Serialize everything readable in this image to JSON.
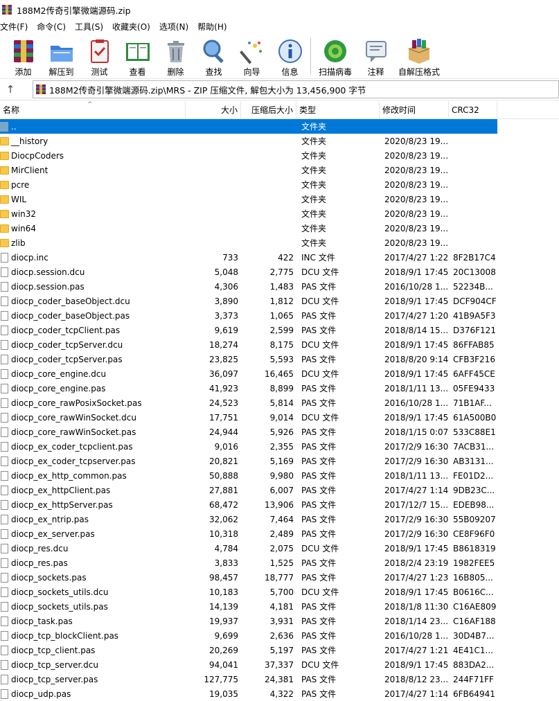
{
  "window": {
    "title": "188M2传奇引擎微端源码.zip"
  },
  "menu": [
    "文件(F)",
    "命令(C)",
    "工具(S)",
    "收藏夹(O)",
    "选项(N)",
    "帮助(H)"
  ],
  "toolbar": {
    "buttons": [
      {
        "label": "添加",
        "icon": "add-icon"
      },
      {
        "label": "解压到",
        "icon": "extract-to-icon"
      },
      {
        "label": "测试",
        "icon": "test-icon"
      },
      {
        "label": "查看",
        "icon": "view-icon"
      },
      {
        "label": "删除",
        "icon": "delete-icon"
      },
      {
        "label": "查找",
        "icon": "find-icon"
      },
      {
        "label": "向导",
        "icon": "wizard-icon"
      },
      {
        "label": "信息",
        "icon": "info-icon"
      },
      {
        "label": "扫描病毒",
        "icon": "virus-scan-icon"
      },
      {
        "label": "注释",
        "icon": "comment-icon"
      },
      {
        "label": "自解压格式",
        "icon": "sfx-icon"
      }
    ]
  },
  "address": {
    "path": "188M2传奇引擎微端源码.zip\\MRS - ZIP 压缩文件, 解包大小为 13,456,900 字节"
  },
  "columns": {
    "name": "名称",
    "size": "大小",
    "packed": "压缩后大小",
    "type": "类型",
    "modified": "修改时间",
    "crc": "CRC32"
  },
  "rows": [
    {
      "name": "..",
      "size": "",
      "packed": "",
      "type": "文件夹",
      "modified": "",
      "crc": "",
      "kind": "up"
    },
    {
      "name": "__history",
      "size": "",
      "packed": "",
      "type": "文件夹",
      "modified": "2020/8/23 19...",
      "crc": "",
      "kind": "folder"
    },
    {
      "name": "DiocpCoders",
      "size": "",
      "packed": "",
      "type": "文件夹",
      "modified": "2020/8/23 19...",
      "crc": "",
      "kind": "folder"
    },
    {
      "name": "MirClient",
      "size": "",
      "packed": "",
      "type": "文件夹",
      "modified": "2020/8/23 19...",
      "crc": "",
      "kind": "folder"
    },
    {
      "name": "pcre",
      "size": "",
      "packed": "",
      "type": "文件夹",
      "modified": "2020/8/23 19...",
      "crc": "",
      "kind": "folder"
    },
    {
      "name": "WIL",
      "size": "",
      "packed": "",
      "type": "文件夹",
      "modified": "2020/8/23 19...",
      "crc": "",
      "kind": "folder"
    },
    {
      "name": "win32",
      "size": "",
      "packed": "",
      "type": "文件夹",
      "modified": "2020/8/23 19...",
      "crc": "",
      "kind": "folder"
    },
    {
      "name": "win64",
      "size": "",
      "packed": "",
      "type": "文件夹",
      "modified": "2020/8/23 19...",
      "crc": "",
      "kind": "folder"
    },
    {
      "name": "zlib",
      "size": "",
      "packed": "",
      "type": "文件夹",
      "modified": "2020/8/23 19...",
      "crc": "",
      "kind": "folder"
    },
    {
      "name": "diocp.inc",
      "size": "733",
      "packed": "422",
      "type": "INC 文件",
      "modified": "2017/4/27 1:22",
      "crc": "8F2B17C4",
      "kind": "file"
    },
    {
      "name": "diocp.session.dcu",
      "size": "5,048",
      "packed": "2,775",
      "type": "DCU 文件",
      "modified": "2018/9/1 17:45",
      "crc": "20C13008",
      "kind": "file"
    },
    {
      "name": "diocp.session.pas",
      "size": "4,306",
      "packed": "1,483",
      "type": "PAS 文件",
      "modified": "2016/10/28 1...",
      "crc": "52234B...",
      "kind": "file"
    },
    {
      "name": "diocp_coder_baseObject.dcu",
      "size": "3,890",
      "packed": "1,812",
      "type": "DCU 文件",
      "modified": "2018/9/1 17:45",
      "crc": "DCF904CF",
      "kind": "file"
    },
    {
      "name": "diocp_coder_baseObject.pas",
      "size": "3,373",
      "packed": "1,065",
      "type": "PAS 文件",
      "modified": "2017/4/27 1:20",
      "crc": "41B9A5F3",
      "kind": "file"
    },
    {
      "name": "diocp_coder_tcpClient.pas",
      "size": "9,619",
      "packed": "2,599",
      "type": "PAS 文件",
      "modified": "2018/8/14 15...",
      "crc": "D376F121",
      "kind": "file"
    },
    {
      "name": "diocp_coder_tcpServer.dcu",
      "size": "18,274",
      "packed": "8,175",
      "type": "DCU 文件",
      "modified": "2018/9/1 17:45",
      "crc": "86FFAB85",
      "kind": "file"
    },
    {
      "name": "diocp_coder_tcpServer.pas",
      "size": "23,825",
      "packed": "5,593",
      "type": "PAS 文件",
      "modified": "2018/8/20 9:14",
      "crc": "CFB3F216",
      "kind": "file"
    },
    {
      "name": "diocp_core_engine.dcu",
      "size": "36,097",
      "packed": "16,465",
      "type": "DCU 文件",
      "modified": "2018/9/1 17:45",
      "crc": "6AFF45CE",
      "kind": "file"
    },
    {
      "name": "diocp_core_engine.pas",
      "size": "41,923",
      "packed": "8,899",
      "type": "PAS 文件",
      "modified": "2018/1/11 13...",
      "crc": "05FE9433",
      "kind": "file"
    },
    {
      "name": "diocp_core_rawPosixSocket.pas",
      "size": "24,523",
      "packed": "5,814",
      "type": "PAS 文件",
      "modified": "2016/10/28 1...",
      "crc": "71B1AF...",
      "kind": "file"
    },
    {
      "name": "diocp_core_rawWinSocket.dcu",
      "size": "17,751",
      "packed": "9,014",
      "type": "DCU 文件",
      "modified": "2018/9/1 17:45",
      "crc": "61A500B0",
      "kind": "file"
    },
    {
      "name": "diocp_core_rawWinSocket.pas",
      "size": "24,944",
      "packed": "5,926",
      "type": "PAS 文件",
      "modified": "2018/1/15 0:07",
      "crc": "533C88E1",
      "kind": "file"
    },
    {
      "name": "diocp_ex_coder_tcpclient.pas",
      "size": "9,016",
      "packed": "2,355",
      "type": "PAS 文件",
      "modified": "2017/2/9 16:30",
      "crc": "7ACB31...",
      "kind": "file"
    },
    {
      "name": "diocp_ex_coder_tcpserver.pas",
      "size": "20,821",
      "packed": "5,169",
      "type": "PAS 文件",
      "modified": "2017/2/9 16:30",
      "crc": "AB3131...",
      "kind": "file"
    },
    {
      "name": "diocp_ex_http_common.pas",
      "size": "50,888",
      "packed": "9,980",
      "type": "PAS 文件",
      "modified": "2018/1/11 13...",
      "crc": "FE01D2...",
      "kind": "file"
    },
    {
      "name": "diocp_ex_httpClient.pas",
      "size": "27,881",
      "packed": "6,007",
      "type": "PAS 文件",
      "modified": "2017/4/27 1:14",
      "crc": "9DB23C...",
      "kind": "file"
    },
    {
      "name": "diocp_ex_httpServer.pas",
      "size": "68,472",
      "packed": "13,906",
      "type": "PAS 文件",
      "modified": "2017/12/7 15...",
      "crc": "EDEB98...",
      "kind": "file"
    },
    {
      "name": "diocp_ex_ntrip.pas",
      "size": "32,062",
      "packed": "7,464",
      "type": "PAS 文件",
      "modified": "2017/2/9 16:30",
      "crc": "55B09207",
      "kind": "file"
    },
    {
      "name": "diocp_ex_server.pas",
      "size": "10,318",
      "packed": "2,489",
      "type": "PAS 文件",
      "modified": "2017/2/9 16:30",
      "crc": "CE8F96F0",
      "kind": "file"
    },
    {
      "name": "diocp_res.dcu",
      "size": "4,784",
      "packed": "2,075",
      "type": "DCU 文件",
      "modified": "2018/9/1 17:45",
      "crc": "B8618319",
      "kind": "file"
    },
    {
      "name": "diocp_res.pas",
      "size": "3,833",
      "packed": "1,525",
      "type": "PAS 文件",
      "modified": "2018/2/4 23:19",
      "crc": "1982FEE5",
      "kind": "file"
    },
    {
      "name": "diocp_sockets.pas",
      "size": "98,457",
      "packed": "18,777",
      "type": "PAS 文件",
      "modified": "2017/4/27 1:23",
      "crc": "16B805...",
      "kind": "file"
    },
    {
      "name": "diocp_sockets_utils.dcu",
      "size": "10,183",
      "packed": "5,700",
      "type": "DCU 文件",
      "modified": "2018/9/1 17:45",
      "crc": "B0616C...",
      "kind": "file"
    },
    {
      "name": "diocp_sockets_utils.pas",
      "size": "14,139",
      "packed": "4,181",
      "type": "PAS 文件",
      "modified": "2018/1/8 11:30",
      "crc": "C16AE809",
      "kind": "file"
    },
    {
      "name": "diocp_task.pas",
      "size": "19,937",
      "packed": "3,931",
      "type": "PAS 文件",
      "modified": "2018/1/14 23...",
      "crc": "C16AF188",
      "kind": "file"
    },
    {
      "name": "diocp_tcp_blockClient.pas",
      "size": "9,699",
      "packed": "2,636",
      "type": "PAS 文件",
      "modified": "2016/10/28 1...",
      "crc": "30D4B7...",
      "kind": "file"
    },
    {
      "name": "diocp_tcp_client.pas",
      "size": "20,269",
      "packed": "5,197",
      "type": "PAS 文件",
      "modified": "2017/4/27 1:21",
      "crc": "4E41C1...",
      "kind": "file"
    },
    {
      "name": "diocp_tcp_server.dcu",
      "size": "94,041",
      "packed": "37,337",
      "type": "DCU 文件",
      "modified": "2018/9/1 17:45",
      "crc": "883DA2...",
      "kind": "file"
    },
    {
      "name": "diocp_tcp_server.pas",
      "size": "127,775",
      "packed": "24,381",
      "type": "PAS 文件",
      "modified": "2018/8/12 23...",
      "crc": "244F71FF",
      "kind": "file"
    },
    {
      "name": "diocp_udp.pas",
      "size": "19,035",
      "packed": "4,322",
      "type": "PAS 文件",
      "modified": "2017/4/27 1:14",
      "crc": "6FB64941",
      "kind": "file"
    }
  ]
}
